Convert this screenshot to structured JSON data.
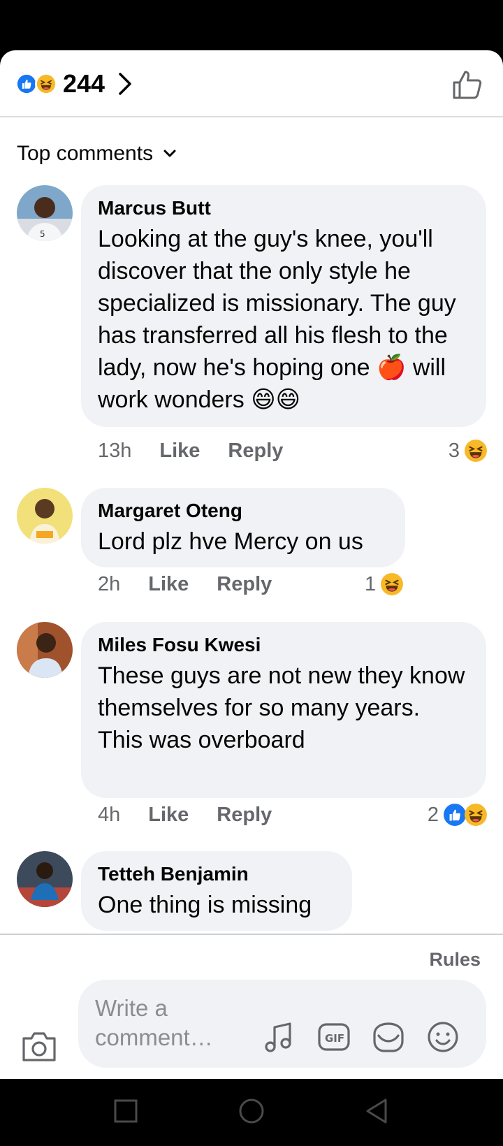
{
  "reactions": {
    "total": "244",
    "icons": [
      "like-icon",
      "haha-icon"
    ]
  },
  "sort": {
    "label": "Top comments"
  },
  "comments": [
    {
      "author": "Marcus Butt",
      "text": "Looking at the guy's knee, you'll discover that the only style he specialized is missionary. The guy has transferred all his flesh to the lady, now he's hoping one 🍎 will work wonders 😄😄",
      "time": "13h",
      "like_label": "Like",
      "reply_label": "Reply",
      "reaction_count": "3",
      "reaction_icons": [
        "haha-icon"
      ]
    },
    {
      "author": "Margaret Oteng",
      "text": "Lord plz hve Mercy on us",
      "time": "2h",
      "like_label": "Like",
      "reply_label": "Reply",
      "reaction_count": "1",
      "reaction_icons": [
        "haha-icon"
      ]
    },
    {
      "author": "Miles Fosu Kwesi",
      "text": "These guys are not new they know themselves for so many years.\nThis was overboard",
      "time": "4h",
      "like_label": "Like",
      "reply_label": "Reply",
      "reaction_count": "2",
      "reaction_icons": [
        "like-icon",
        "haha-icon"
      ]
    },
    {
      "author": "Tetteh Benjamin",
      "text": "One thing is missing"
    }
  ],
  "footer": {
    "rules_label": "Rules",
    "placeholder": "Write a comment…"
  },
  "colors": {
    "like_blue": "#1877f2",
    "haha_yellow": "#f7b928",
    "bubble_bg": "#f0f2f5",
    "meta_gray": "#65676b"
  }
}
